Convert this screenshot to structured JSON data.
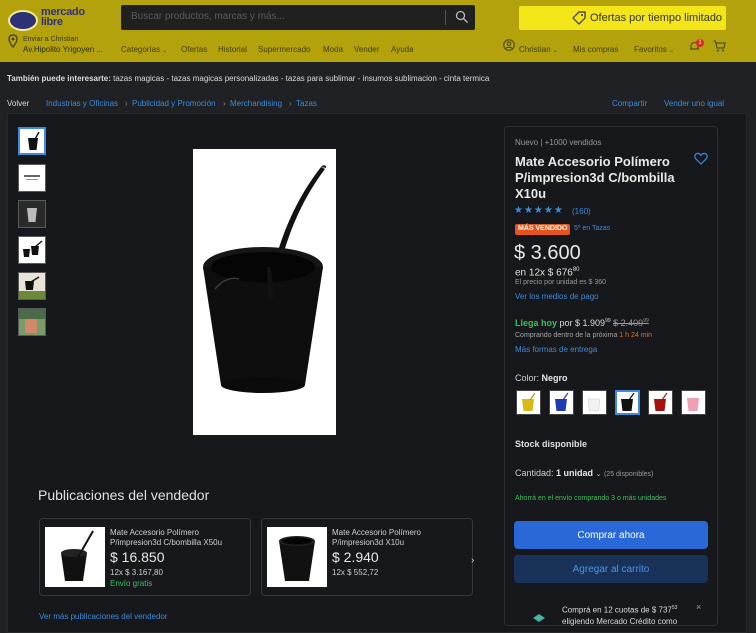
{
  "header": {
    "logo_line1": "mercado",
    "logo_line2": "libre",
    "search_placeholder": "Buscar productos, marcas y más...",
    "promo_label": "Ofertas por tiempo limitado",
    "ship_line1": "Enviar a Christian",
    "ship_line2": "Av.Hipolito Yrigoyen ...",
    "nav": [
      "Categorías",
      "Ofertas",
      "Historial",
      "Supermercado",
      "Moda",
      "Vender",
      "Ayuda"
    ],
    "user": "Christian",
    "purchases": "Mis compras",
    "favorites": "Favoritos",
    "notif_count": "1"
  },
  "suggestions": {
    "label": "También puede interesarte:",
    "items": "tazas magicas - tazas magicas personalizadas - tazas para sublimar - insumos sublimacion - cinta termica"
  },
  "breadcrumb": {
    "back": "Volver",
    "items": [
      "Industrias y Oficinas",
      "Publicidad y Promoción",
      "Merchandising",
      "Tazas"
    ],
    "share": "Compartir",
    "sell_one": "Vender uno igual"
  },
  "product": {
    "condition": "Nuevo  |  +1000 vendidos",
    "title_line1": "Mate Accesorio Polímero",
    "title_line2": "P/impresion3d C/bombilla",
    "title_line3": "X10u",
    "rating": 5,
    "stars": "★★★★★",
    "reviews": "(160)",
    "badge": "MÁS VENDIDO",
    "badge_rank": "5º en Tazas",
    "price": "$ 3.600",
    "installments": "en 12x $ 676",
    "installments_cents": "80",
    "unit_price": "El precio por unidad es $ 360",
    "payment_link": "Ver los medios de pago",
    "arrives": "Llega hoy",
    "arrives_price": "por $ 1.909",
    "arrives_cents": "99",
    "arrives_old": "$ 2.409",
    "arrives_old_cents": "99",
    "buy_within": "Comprando dentro de la próxima",
    "countdown": "1 h 24 min",
    "more_shipping": "Más formas de entrega",
    "color_label": "Color:",
    "color_value": "Negro",
    "swatch_colors": [
      "#d8b917",
      "#1d3bb0",
      "#f2f2f0",
      "#111111",
      "#a51212",
      "#ee9fb4"
    ],
    "stock": "Stock disponible",
    "quantity_label": "Cantidad:",
    "quantity_value": "1 unidad",
    "available": "(25 disponibles)",
    "savings": "Ahorrá en el envío comprando 3 o más unidades",
    "buy_now": "Comprar ahora",
    "add_cart": "Agregar al carrito",
    "credit_line1": "Comprá en 12 cuotas de $ 737",
    "credit_cents": "53",
    "credit_line2": "eligiendo Mercado Crédito como"
  },
  "seller": {
    "title": "Publicaciones del vendedor",
    "more_link": "Ver más publicaciones del vendedor",
    "items": [
      {
        "title1": "Mate Accesorio Polímero",
        "title2": "P/impresion3d C/bombilla X50u",
        "price": "$ 16.850",
        "installments": "12x $ 3.167,80",
        "shipping": "Envío gratis"
      },
      {
        "title1": "Mate Accesorio Polímero",
        "title2": "P/impresion3d X10u",
        "price": "$ 2.940",
        "installments": "12x $ 552,72",
        "shipping": ""
      }
    ]
  },
  "colors": {
    "accent": "#3e8bdb",
    "header_bg": "#b3a20c",
    "buy_button": "#2a68d8",
    "green": "#3fbf5f"
  }
}
